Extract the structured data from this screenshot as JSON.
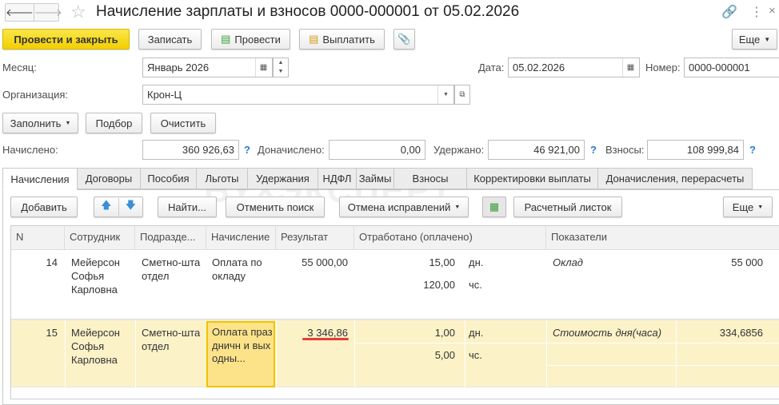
{
  "window": {
    "title": "Начисление зарплаты и взносов 0000-000001 от 05.02.2026"
  },
  "toolbar": {
    "post_close": "Провести и закрыть",
    "save": "Записать",
    "post": "Провести",
    "pay": "Выплатить",
    "more": "Еще"
  },
  "fields": {
    "month_label": "Месяц:",
    "month": "Январь 2026",
    "date_label": "Дата:",
    "date": "05.02.2026",
    "number_label": "Номер:",
    "number": "0000-000001",
    "org_label": "Организация:",
    "org": "Крон-Ц"
  },
  "actions": {
    "fill": "Заполнить",
    "select": "Подбор",
    "clear": "Очистить"
  },
  "totals": {
    "accrued_label": "Начислено:",
    "accrued": "360 926,63",
    "extra_label": "Доначислено:",
    "extra": "0,00",
    "withheld_label": "Удержано:",
    "withheld": "46 921,00",
    "contrib_label": "Взносы:",
    "contrib": "108 999,84",
    "help": "?"
  },
  "tabs": [
    "Начисления",
    "Договоры",
    "Пособия",
    "Льготы",
    "Удержания",
    "НДФЛ",
    "Займы",
    "Взносы",
    "Корректировки выплаты",
    "Доначисления, перерасчеты"
  ],
  "table_toolbar": {
    "add": "Добавить",
    "find": "Найти...",
    "cancel_search": "Отменить поиск",
    "cancel_fix": "Отмена исправлений",
    "payslip": "Расчетный листок",
    "more": "Еще"
  },
  "watermark": "БУХЭКСПЕРТ",
  "table": {
    "columns": [
      "N",
      "Сотрудник",
      "Подразде...",
      "Начисление",
      "Результат",
      "Отработано (оплачено)",
      "Показатели"
    ],
    "rows": [
      {
        "n": "14",
        "employee": "Мейерсон Софья Карловна",
        "dept": "Сметно-шта отдел",
        "accrual": "Оплата по окладу",
        "result": "55 000,00",
        "days": "15,00",
        "days_unit": "дн.",
        "hours": "120,00",
        "hours_unit": "чс.",
        "indicator": "Оклад",
        "indicator_value": "55 000"
      },
      {
        "n": "15",
        "employee": "Мейерсон Софья Карловна",
        "dept": "Сметно-шта отдел",
        "accrual": "Оплата праздничн и выходны...",
        "result": "3 346,86",
        "days": "1,00",
        "days_unit": "дн.",
        "hours": "5,00",
        "hours_unit": "чс.",
        "indicator": "Стоимость дня(часа)",
        "indicator_value": "334,6856"
      }
    ]
  }
}
